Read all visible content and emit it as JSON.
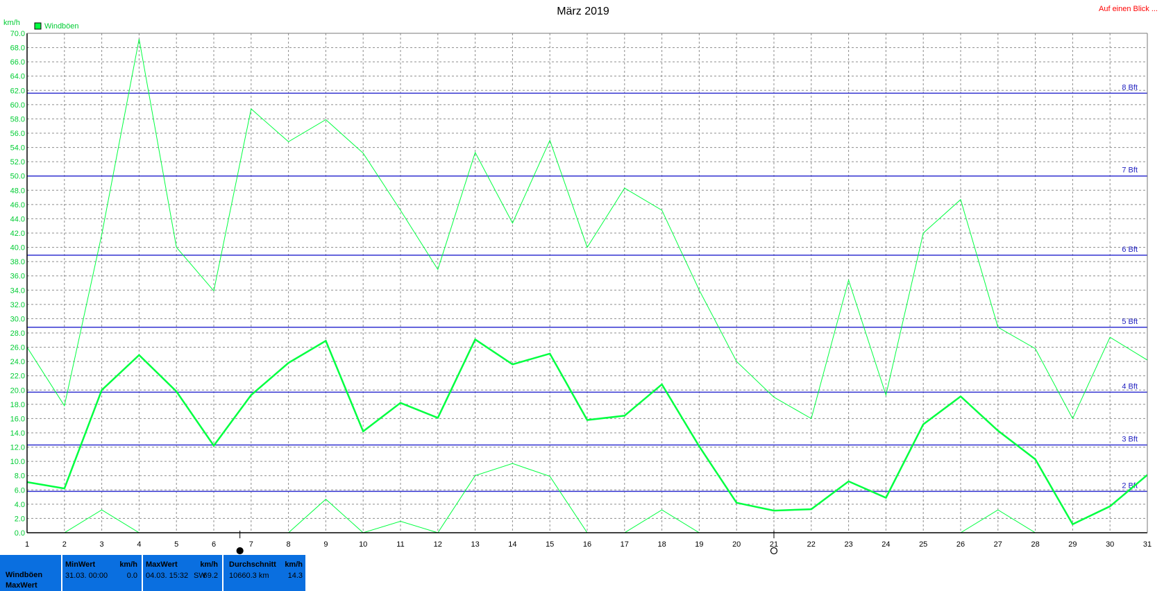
{
  "header": {
    "title": "März 2019",
    "top_right_link": "Auf einen Blick ..."
  },
  "colors": {
    "series": "#00ff40",
    "beaufort_lines": "#3030d0",
    "grid": "#8c8c8c",
    "link": "#ff0000",
    "footer": "#0a6fe0"
  },
  "chart_data": {
    "type": "line",
    "title": "März 2019",
    "ylabel": "km/h",
    "legend": [
      "Windböen"
    ],
    "legend_position": "top-left",
    "ylim": [
      0,
      70
    ],
    "y_tick_step": 2,
    "x": [
      1,
      2,
      3,
      4,
      5,
      6,
      7,
      8,
      9,
      10,
      11,
      12,
      13,
      14,
      15,
      16,
      17,
      18,
      19,
      20,
      21,
      22,
      23,
      24,
      25,
      26,
      27,
      28,
      29,
      30,
      31
    ],
    "grid": true,
    "series": [
      {
        "name": "Windböen",
        "role": "max",
        "line_width": 1,
        "values": [
          26.0,
          17.8,
          41.8,
          69.2,
          40.0,
          33.9,
          59.4,
          54.8,
          57.9,
          53.2,
          45.2,
          36.9,
          53.3,
          43.4,
          55.0,
          40.0,
          48.3,
          45.2,
          34.0,
          24.0,
          19.0,
          16.0,
          35.4,
          19.3,
          42.0,
          46.7,
          28.8,
          25.8,
          16.0,
          27.4,
          24.2
        ]
      },
      {
        "name": "Windböen",
        "role": "avg",
        "line_width": 2.5,
        "values": [
          7.1,
          6.2,
          20.0,
          24.9,
          19.8,
          12.2,
          19.3,
          23.8,
          26.9,
          14.2,
          18.2,
          16.1,
          27.1,
          23.6,
          25.1,
          15.8,
          16.4,
          20.8,
          12.1,
          4.2,
          3.1,
          3.3,
          7.2,
          4.9,
          15.2,
          19.1,
          14.3,
          10.3,
          1.2,
          3.7,
          8.1
        ]
      },
      {
        "name": "Windböen",
        "role": "min",
        "line_width": 1,
        "values": [
          null,
          0.0,
          3.2,
          0.0,
          null,
          null,
          null,
          0.0,
          4.7,
          0.0,
          1.6,
          0.0,
          8.0,
          9.7,
          7.9,
          0.0,
          0.0,
          3.2,
          0.0,
          null,
          null,
          null,
          null,
          null,
          null,
          0.0,
          3.2,
          0.0,
          null,
          null,
          null
        ]
      }
    ],
    "reference_lines": [
      {
        "label": "2 Bft",
        "value": 5.8
      },
      {
        "label": "3 Bft",
        "value": 12.3
      },
      {
        "label": "4 Bft",
        "value": 19.7
      },
      {
        "label": "5 Bft",
        "value": 28.8
      },
      {
        "label": "6 Bft",
        "value": 38.9
      },
      {
        "label": "7 Bft",
        "value": 50.0
      },
      {
        "label": "8 Bft",
        "value": 61.6
      }
    ],
    "markers": [
      {
        "day": 6.7,
        "symbol": "filled-circle"
      },
      {
        "day": 21,
        "symbol": "open-circle"
      }
    ]
  },
  "footer": {
    "series_label": "Windböen",
    "series_sub_label": "MaxWert",
    "min": {
      "header": "MinWert",
      "unit": "km/h",
      "datetime": "31.03.  00:00",
      "value": "0.0"
    },
    "max": {
      "header": "MaxWert",
      "unit": "km/h",
      "datetime": "04.03.  15:32",
      "direction": "SW",
      "value": "69.2"
    },
    "avg": {
      "header": "Durchschnitt",
      "unit": "km/h",
      "distance": "10660.3 km",
      "value": "14.3"
    }
  }
}
